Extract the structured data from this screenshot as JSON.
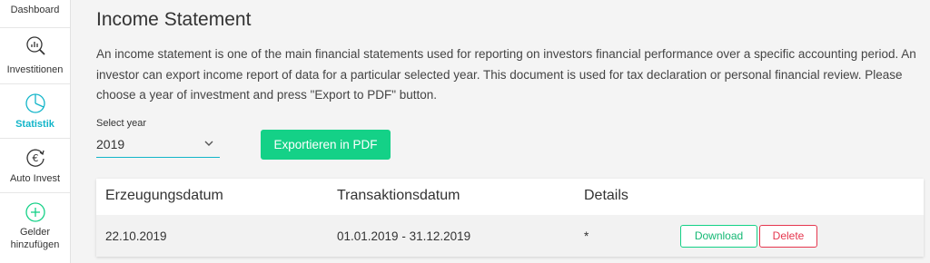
{
  "sidebar": {
    "items": [
      {
        "label": "Dashboard",
        "icon": "dashboard-icon",
        "active": false
      },
      {
        "label": "Investitionen",
        "icon": "magnifier-chart-icon",
        "active": false
      },
      {
        "label": "Statistik",
        "icon": "pie-chart-icon",
        "active": true
      },
      {
        "label": "Auto Invest",
        "icon": "euro-cycle-icon",
        "active": false
      },
      {
        "label": "Gelder hinzufügen",
        "icon": "plus-circle-icon",
        "active": false
      }
    ]
  },
  "page": {
    "title": "Income Statement",
    "description": "An income statement is one of the main financial statements used for reporting on investors financial performance over a specific accounting period. An investor can export income report of data for a particular selected year. This document is used for tax declaration or personal financial review. Please choose a year of investment and press \"Export to PDF\" button."
  },
  "year_select": {
    "label": "Select year",
    "value": "2019"
  },
  "export_button": "Exportieren in PDF",
  "table": {
    "headers": [
      "Erzeugungsdatum",
      "Transaktionsdatum",
      "Details"
    ],
    "rows": [
      {
        "created": "22.10.2019",
        "period": "01.01.2019 - 31.12.2019",
        "details": "*",
        "download": "Download",
        "delete": "Delete"
      }
    ]
  },
  "colors": {
    "accent": "#12b5c9",
    "primary_button": "#14d187",
    "danger": "#e5364e"
  }
}
